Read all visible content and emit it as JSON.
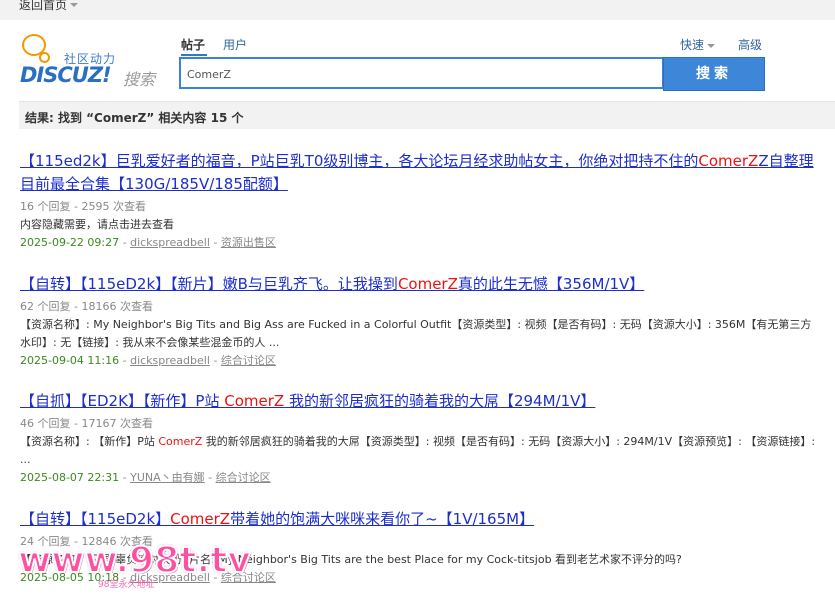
{
  "topbar": {
    "back_label": "返回首页"
  },
  "logo": {
    "tagline": "社区动力",
    "brand": "DISCUZ!",
    "search_word": "搜索"
  },
  "search": {
    "tabs": [
      {
        "label": "帖子"
      },
      {
        "label": "用户"
      }
    ],
    "quick_label": "快速",
    "advanced_label": "高级",
    "query": "ComerZ",
    "button_label": "搜索"
  },
  "result_summary": "结果: 找到 “ComerZ” 相关内容 15 个",
  "results": [
    {
      "title_pre": "【115ed2k】巨乳爱好者的福音，P站巨乳T0级别博主，各大论坛月经求助帖女主，你绝对把持不住的",
      "title_hl": "ComerZ",
      "title_post": "Z自整理目前最全合集【130G/185V/185配额】",
      "meta": "16 个回复 - 2595 次查看",
      "snippet": "内容隐藏需要，请点击进去查看",
      "date": "2025-09-22 09:27",
      "author": "dickspreadbell",
      "forum": "资源出售区"
    },
    {
      "title_pre": "【自转】【115eD2k】【新片】嫩B与巨乳齐飞。让我操到",
      "title_hl": "ComerZ",
      "title_post": "真的此生无憾【356M/1V】",
      "meta": "62 个回复 - 18166 次查看",
      "snippet": "【资源名称】: My Neighbor's Big Tits and Big Ass are Fucked in a Colorful Outfit【资源类型】: 视频【是否有码】: 无码【资源大小】: 356M【有无第三方水印】: 无【链接】: 我从来不会像某些混金币的人 ...",
      "date": "2025-09-04 11:16",
      "author": "dickspreadbell",
      "forum": "综合讨论区"
    },
    {
      "title_pre": "【自抓】【ED2K】【新作】P站 ",
      "title_hl": "ComerZ",
      "title_post": " 我的新邻居疯狂的骑着我的大屌【294M/1V】",
      "meta": "46 个回复 - 17167 次查看",
      "snippet_pre": "【资源名称】: 【新作】P站 ",
      "snippet_hl": "ComerZ",
      "snippet_post": " 我的新邻居疯狂的骑着我的大屌【资源类型】: 视频【是否有码】: 无码【资源大小】: 294M/1V【资源预览】: 【资源链接】: ...",
      "date": "2025-08-07 22:31",
      "author": "YUNA丶由有娜",
      "forum": "综合讨论区"
    },
    {
      "title_pre": "【自转】【115eD2k】",
      "title_hl": "ComerZ",
      "title_post": "带着她的饱满大咪咪来看你了~【1V/165M】",
      "meta": "24 个回复 - 12846 次查看",
      "snippet": "【资源名称】: 不要辜负这对大奶! 片名: My Neighbor's Big Tits are the best Place for my Cock-titsjob 看到老艺术家不评分的吗?",
      "date": "2025-08-05 10:18",
      "author": "dickspreadbell",
      "forum": "综合讨论区"
    }
  ],
  "watermark": {
    "text": "www.98t.tv",
    "sub": "98堂永久地址"
  }
}
